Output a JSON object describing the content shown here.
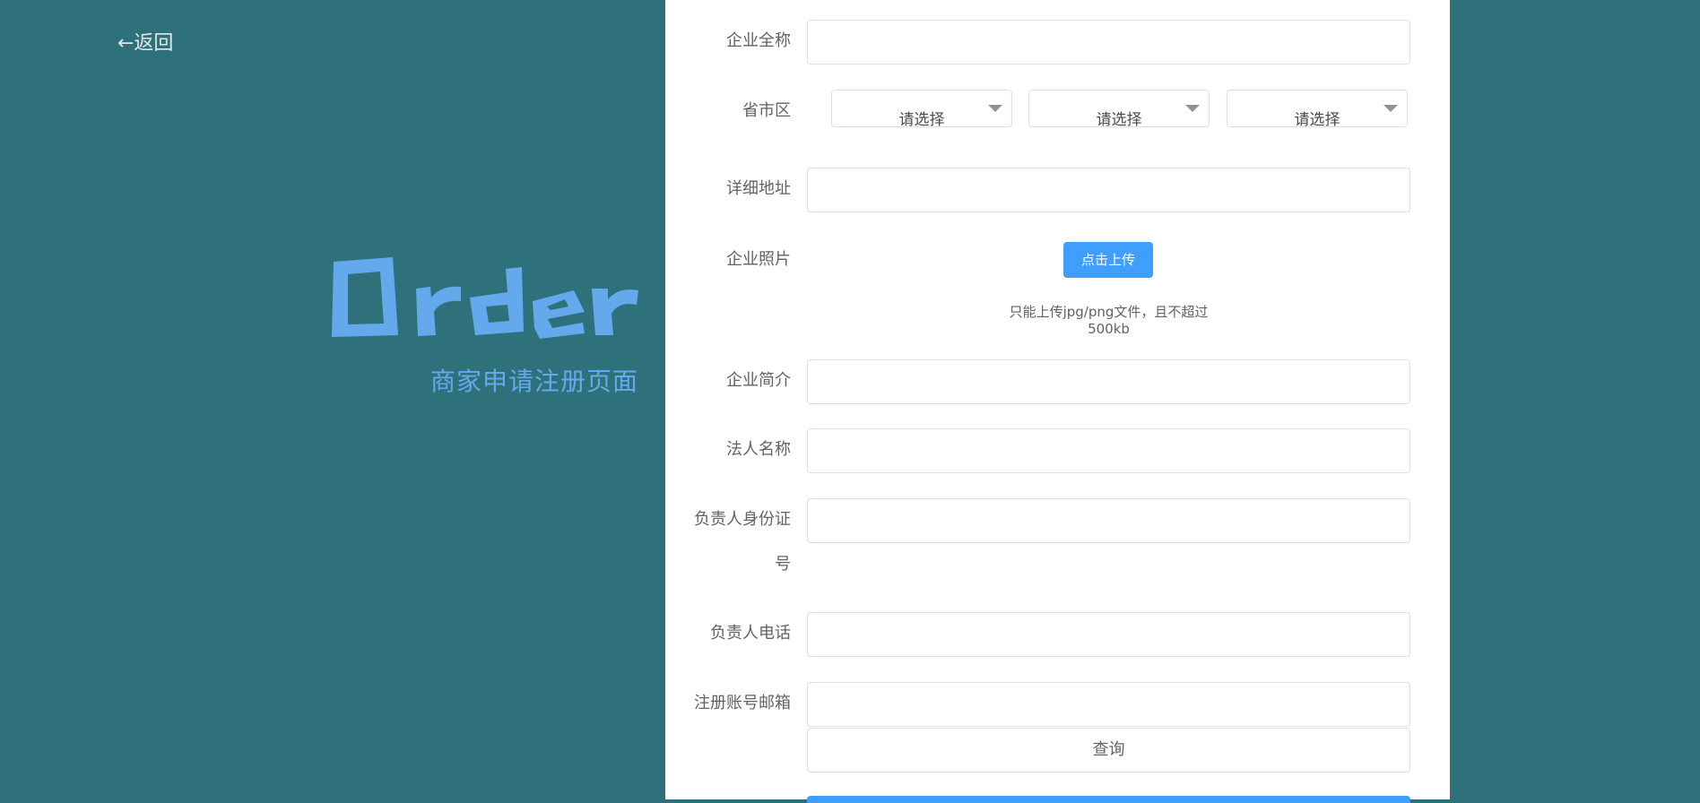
{
  "nav": {
    "back_label": "←返回"
  },
  "hero": {
    "logo_text": "Order",
    "subtitle": "商家申请注册页面"
  },
  "colors": {
    "background": "#2f717b",
    "accent": "#409eff",
    "logo": "#64a9ec"
  },
  "form": {
    "company_name": {
      "label": "企业全称",
      "value": ""
    },
    "region": {
      "label": "省市区",
      "province": "请选择",
      "city": "请选择",
      "district": "请选择"
    },
    "address": {
      "label": "详细地址",
      "value": ""
    },
    "photo": {
      "label": "企业照片",
      "upload_label": "点击上传",
      "hint": "只能上传jpg/png文件，且不超过500kb"
    },
    "intro": {
      "label": "企业简介",
      "value": ""
    },
    "legal_name": {
      "label": "法人名称",
      "value": ""
    },
    "id_number": {
      "label_line1": "负责人身份证",
      "label_line2": "号",
      "value": ""
    },
    "phone": {
      "label": "负责人电话",
      "value": ""
    },
    "email": {
      "label": "注册账号邮箱",
      "value": ""
    },
    "query_label": "查询"
  }
}
